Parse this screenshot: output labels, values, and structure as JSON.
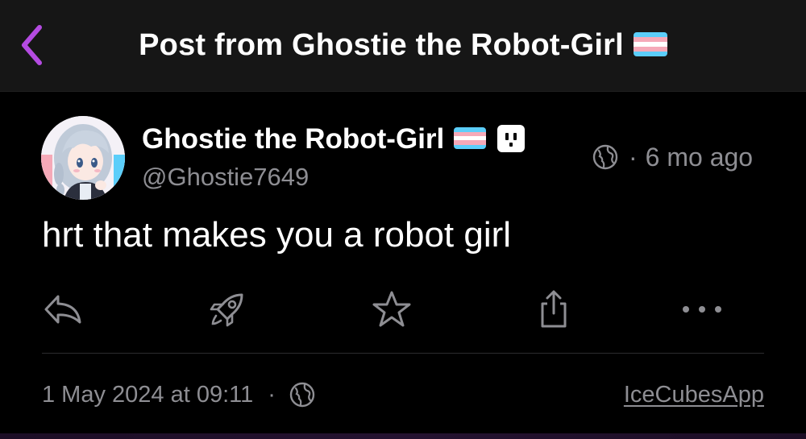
{
  "nav": {
    "title": "Post from Ghostie the Robot-Girl",
    "accent_color": "#b44be1"
  },
  "post": {
    "author": {
      "display_name": "Ghostie the Robot-Girl",
      "handle": "@Ghostie7649",
      "flag": "transgender-flag",
      "badge_icon": "power-plug-icon"
    },
    "visibility_icon": "globe-icon",
    "relative_time": "6 mo ago",
    "separator": "·",
    "content": "hrt that makes you a robot girl",
    "actions": [
      {
        "name": "reply",
        "icon": "reply-icon"
      },
      {
        "name": "boost",
        "icon": "rocket-icon"
      },
      {
        "name": "favorite",
        "icon": "star-icon"
      },
      {
        "name": "share",
        "icon": "share-icon"
      },
      {
        "name": "more",
        "icon": "ellipsis-icon"
      }
    ],
    "footer": {
      "timestamp": "1 May 2024 at 09:11",
      "separator": "·",
      "visibility_icon": "globe-icon",
      "app_name": "IceCubesApp"
    }
  },
  "colors": {
    "background": "#000000",
    "nav_background": "#161616",
    "secondary_text": "#8e8e93",
    "flag_blue": "#5bcefa",
    "flag_pink": "#f5a9b8",
    "flag_white": "#ffffff"
  }
}
